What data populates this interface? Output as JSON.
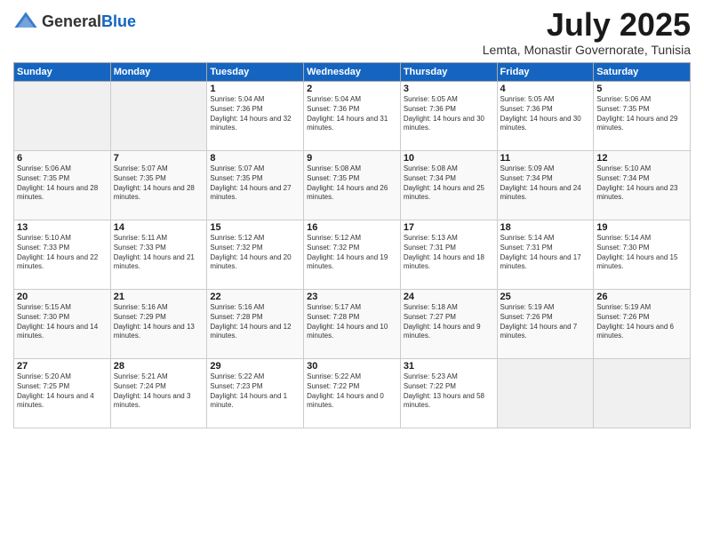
{
  "logo": {
    "general": "General",
    "blue": "Blue"
  },
  "title": {
    "month_year": "July 2025",
    "location": "Lemta, Monastir Governorate, Tunisia"
  },
  "headers": [
    "Sunday",
    "Monday",
    "Tuesday",
    "Wednesday",
    "Thursday",
    "Friday",
    "Saturday"
  ],
  "weeks": [
    [
      {
        "day": "",
        "sunrise": "",
        "sunset": "",
        "daylight": "",
        "empty": true
      },
      {
        "day": "",
        "sunrise": "",
        "sunset": "",
        "daylight": "",
        "empty": true
      },
      {
        "day": "1",
        "sunrise": "Sunrise: 5:04 AM",
        "sunset": "Sunset: 7:36 PM",
        "daylight": "Daylight: 14 hours and 32 minutes."
      },
      {
        "day": "2",
        "sunrise": "Sunrise: 5:04 AM",
        "sunset": "Sunset: 7:36 PM",
        "daylight": "Daylight: 14 hours and 31 minutes."
      },
      {
        "day": "3",
        "sunrise": "Sunrise: 5:05 AM",
        "sunset": "Sunset: 7:36 PM",
        "daylight": "Daylight: 14 hours and 30 minutes."
      },
      {
        "day": "4",
        "sunrise": "Sunrise: 5:05 AM",
        "sunset": "Sunset: 7:36 PM",
        "daylight": "Daylight: 14 hours and 30 minutes."
      },
      {
        "day": "5",
        "sunrise": "Sunrise: 5:06 AM",
        "sunset": "Sunset: 7:35 PM",
        "daylight": "Daylight: 14 hours and 29 minutes."
      }
    ],
    [
      {
        "day": "6",
        "sunrise": "Sunrise: 5:06 AM",
        "sunset": "Sunset: 7:35 PM",
        "daylight": "Daylight: 14 hours and 28 minutes."
      },
      {
        "day": "7",
        "sunrise": "Sunrise: 5:07 AM",
        "sunset": "Sunset: 7:35 PM",
        "daylight": "Daylight: 14 hours and 28 minutes."
      },
      {
        "day": "8",
        "sunrise": "Sunrise: 5:07 AM",
        "sunset": "Sunset: 7:35 PM",
        "daylight": "Daylight: 14 hours and 27 minutes."
      },
      {
        "day": "9",
        "sunrise": "Sunrise: 5:08 AM",
        "sunset": "Sunset: 7:35 PM",
        "daylight": "Daylight: 14 hours and 26 minutes."
      },
      {
        "day": "10",
        "sunrise": "Sunrise: 5:08 AM",
        "sunset": "Sunset: 7:34 PM",
        "daylight": "Daylight: 14 hours and 25 minutes."
      },
      {
        "day": "11",
        "sunrise": "Sunrise: 5:09 AM",
        "sunset": "Sunset: 7:34 PM",
        "daylight": "Daylight: 14 hours and 24 minutes."
      },
      {
        "day": "12",
        "sunrise": "Sunrise: 5:10 AM",
        "sunset": "Sunset: 7:34 PM",
        "daylight": "Daylight: 14 hours and 23 minutes."
      }
    ],
    [
      {
        "day": "13",
        "sunrise": "Sunrise: 5:10 AM",
        "sunset": "Sunset: 7:33 PM",
        "daylight": "Daylight: 14 hours and 22 minutes."
      },
      {
        "day": "14",
        "sunrise": "Sunrise: 5:11 AM",
        "sunset": "Sunset: 7:33 PM",
        "daylight": "Daylight: 14 hours and 21 minutes."
      },
      {
        "day": "15",
        "sunrise": "Sunrise: 5:12 AM",
        "sunset": "Sunset: 7:32 PM",
        "daylight": "Daylight: 14 hours and 20 minutes."
      },
      {
        "day": "16",
        "sunrise": "Sunrise: 5:12 AM",
        "sunset": "Sunset: 7:32 PM",
        "daylight": "Daylight: 14 hours and 19 minutes."
      },
      {
        "day": "17",
        "sunrise": "Sunrise: 5:13 AM",
        "sunset": "Sunset: 7:31 PM",
        "daylight": "Daylight: 14 hours and 18 minutes."
      },
      {
        "day": "18",
        "sunrise": "Sunrise: 5:14 AM",
        "sunset": "Sunset: 7:31 PM",
        "daylight": "Daylight: 14 hours and 17 minutes."
      },
      {
        "day": "19",
        "sunrise": "Sunrise: 5:14 AM",
        "sunset": "Sunset: 7:30 PM",
        "daylight": "Daylight: 14 hours and 15 minutes."
      }
    ],
    [
      {
        "day": "20",
        "sunrise": "Sunrise: 5:15 AM",
        "sunset": "Sunset: 7:30 PM",
        "daylight": "Daylight: 14 hours and 14 minutes."
      },
      {
        "day": "21",
        "sunrise": "Sunrise: 5:16 AM",
        "sunset": "Sunset: 7:29 PM",
        "daylight": "Daylight: 14 hours and 13 minutes."
      },
      {
        "day": "22",
        "sunrise": "Sunrise: 5:16 AM",
        "sunset": "Sunset: 7:28 PM",
        "daylight": "Daylight: 14 hours and 12 minutes."
      },
      {
        "day": "23",
        "sunrise": "Sunrise: 5:17 AM",
        "sunset": "Sunset: 7:28 PM",
        "daylight": "Daylight: 14 hours and 10 minutes."
      },
      {
        "day": "24",
        "sunrise": "Sunrise: 5:18 AM",
        "sunset": "Sunset: 7:27 PM",
        "daylight": "Daylight: 14 hours and 9 minutes."
      },
      {
        "day": "25",
        "sunrise": "Sunrise: 5:19 AM",
        "sunset": "Sunset: 7:26 PM",
        "daylight": "Daylight: 14 hours and 7 minutes."
      },
      {
        "day": "26",
        "sunrise": "Sunrise: 5:19 AM",
        "sunset": "Sunset: 7:26 PM",
        "daylight": "Daylight: 14 hours and 6 minutes."
      }
    ],
    [
      {
        "day": "27",
        "sunrise": "Sunrise: 5:20 AM",
        "sunset": "Sunset: 7:25 PM",
        "daylight": "Daylight: 14 hours and 4 minutes."
      },
      {
        "day": "28",
        "sunrise": "Sunrise: 5:21 AM",
        "sunset": "Sunset: 7:24 PM",
        "daylight": "Daylight: 14 hours and 3 minutes."
      },
      {
        "day": "29",
        "sunrise": "Sunrise: 5:22 AM",
        "sunset": "Sunset: 7:23 PM",
        "daylight": "Daylight: 14 hours and 1 minute."
      },
      {
        "day": "30",
        "sunrise": "Sunrise: 5:22 AM",
        "sunset": "Sunset: 7:22 PM",
        "daylight": "Daylight: 14 hours and 0 minutes."
      },
      {
        "day": "31",
        "sunrise": "Sunrise: 5:23 AM",
        "sunset": "Sunset: 7:22 PM",
        "daylight": "Daylight: 13 hours and 58 minutes."
      },
      {
        "day": "",
        "sunrise": "",
        "sunset": "",
        "daylight": "",
        "empty": true
      },
      {
        "day": "",
        "sunrise": "",
        "sunset": "",
        "daylight": "",
        "empty": true
      }
    ]
  ]
}
